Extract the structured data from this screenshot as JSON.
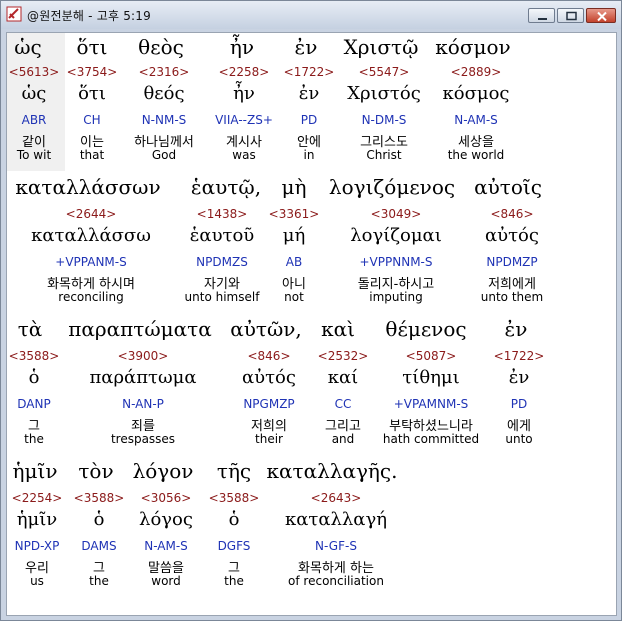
{
  "window": {
    "title": "@원전분해 - 고후 5:19",
    "controls": {
      "minimize": "minimize",
      "maximize": "maximize",
      "close": "close"
    }
  },
  "rows": [
    {
      "heading": [
        "ὡς",
        "ὅτι",
        "θεὸς",
        "ἦν",
        "ἐν",
        "Χριστῷ",
        "κόσμον"
      ],
      "columns": [
        {
          "strong": "<5613>",
          "lemma": "ὡς",
          "parse": "ABR",
          "korean": "같이",
          "english": "To wit"
        },
        {
          "strong": "<3754>",
          "lemma": "ὅτι",
          "parse": "CH",
          "korean": "이는",
          "english": "that"
        },
        {
          "strong": "<2316>",
          "lemma": "θεός",
          "parse": "N-NM-S",
          "korean": "하나님께서",
          "english": "God"
        },
        {
          "strong": "<2258>",
          "lemma": "ἦν",
          "parse": "VIIA--ZS+",
          "korean": "계시사",
          "english": "was"
        },
        {
          "strong": "<1722>",
          "lemma": "ἐν",
          "parse": "PD",
          "korean": "안에",
          "english": "in"
        },
        {
          "strong": "<5547>",
          "lemma": "Χριστός",
          "parse": "N-DM-S",
          "korean": "그리스도",
          "english": "Christ"
        },
        {
          "strong": "<2889>",
          "lemma": "κόσμος",
          "parse": "N-AM-S",
          "korean": "세상을",
          "english": "the world"
        }
      ]
    },
    {
      "heading": [
        "καταλλάσσων",
        "ἑαυτῷ,",
        "μὴ",
        "λογιζόμενος",
        "αὐτοῖς"
      ],
      "columns": [
        {
          "strong": "<2644>",
          "lemma": "καταλλάσσω",
          "parse": "+VPPANM-S",
          "korean": "화목하게 하시며",
          "english": "reconciling"
        },
        {
          "strong": "<1438>",
          "lemma": "ἑαυτοῦ",
          "parse": "NPDMZS",
          "korean": "자기와",
          "english": "unto himself"
        },
        {
          "strong": "<3361>",
          "lemma": "μή",
          "parse": "AB",
          "korean": "아니",
          "english": "not"
        },
        {
          "strong": "<3049>",
          "lemma": "λογίζομαι",
          "parse": "+VPPNNM-S",
          "korean": "돌리지-하시고",
          "english": "imputing"
        },
        {
          "strong": "<846>",
          "lemma": "αὐτός",
          "parse": "NPDMZP",
          "korean": "저희에게",
          "english": "unto them"
        }
      ]
    },
    {
      "heading": [
        "τὰ",
        "παραπτώματα",
        "αὐτῶν,",
        "καὶ",
        "θέμενος",
        "ἐν"
      ],
      "columns": [
        {
          "strong": "<3588>",
          "lemma": "ὁ",
          "parse": "DANP",
          "korean": "그",
          "english": "the"
        },
        {
          "strong": "<3900>",
          "lemma": "παράπτωμα",
          "parse": "N-AN-P",
          "korean": "죄를",
          "english": "trespasses"
        },
        {
          "strong": "<846>",
          "lemma": "αὐτός",
          "parse": "NPGMZP",
          "korean": "저희의",
          "english": "their"
        },
        {
          "strong": "<2532>",
          "lemma": "καί",
          "parse": "CC",
          "korean": "그리고",
          "english": "and"
        },
        {
          "strong": "<5087>",
          "lemma": "τίθημι",
          "parse": "+VPAMNM-S",
          "korean": "부탁하셨느니라",
          "english": "hath committed"
        },
        {
          "strong": "<1722>",
          "lemma": "ἐν",
          "parse": "PD",
          "korean": "에게",
          "english": "unto"
        }
      ]
    },
    {
      "heading": [
        "ἡμῖν",
        "τὸν",
        "λόγον",
        "τῆς",
        "καταλλαγῆς."
      ],
      "columns": [
        {
          "strong": "<2254>",
          "lemma": "ἡμῖν",
          "parse": "NPD-XP",
          "korean": "우리",
          "english": "us"
        },
        {
          "strong": "<3588>",
          "lemma": "ὁ",
          "parse": "DAMS",
          "korean": "그",
          "english": "the"
        },
        {
          "strong": "<3056>",
          "lemma": "λόγος",
          "parse": "N-AM-S",
          "korean": "말씀을",
          "english": "word"
        },
        {
          "strong": "<3588>",
          "lemma": "ὁ",
          "parse": "DGFS",
          "korean": "그",
          "english": "the"
        },
        {
          "strong": "<2643>",
          "lemma": "καταλλαγή",
          "parse": "N-GF-S",
          "korean": "화목하게 하는",
          "english": "of reconciliation"
        }
      ]
    }
  ]
}
